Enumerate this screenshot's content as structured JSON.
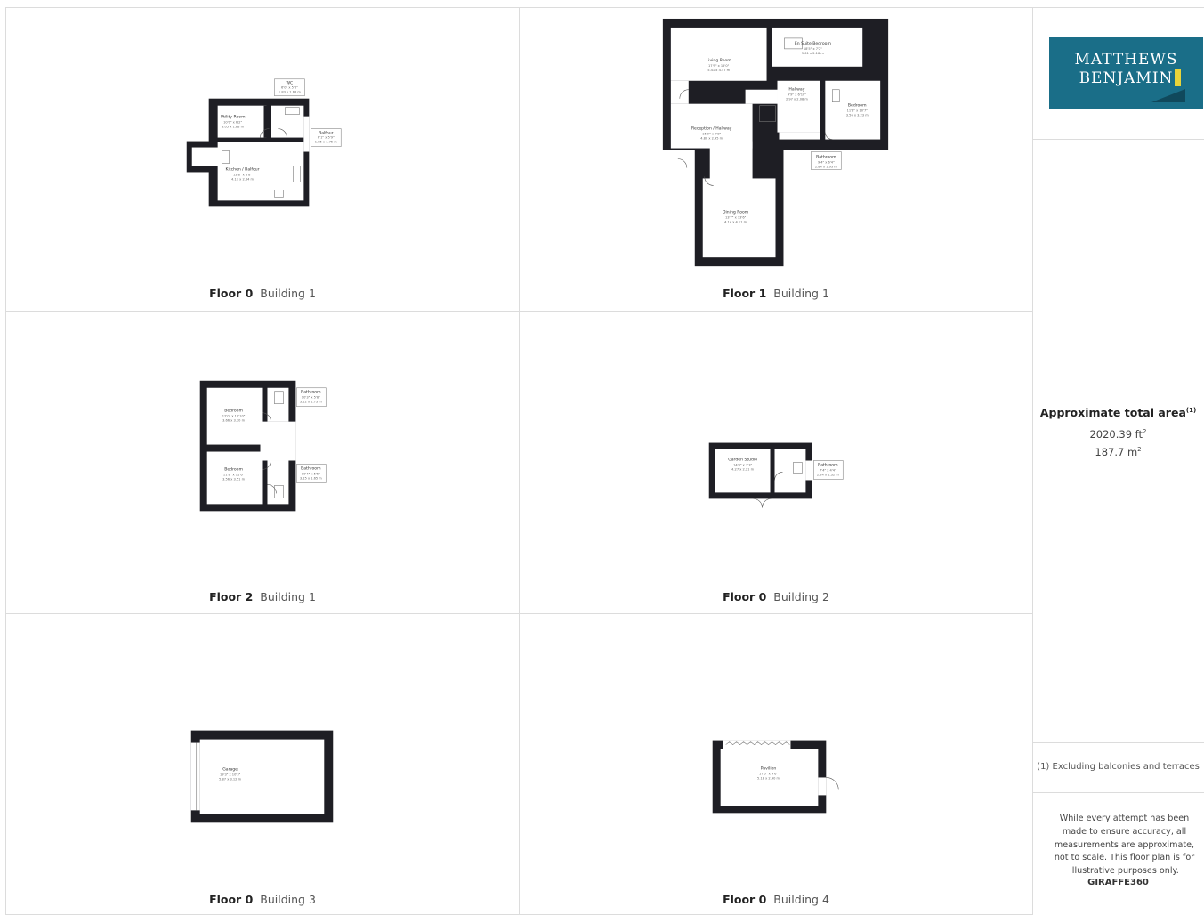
{
  "plans": [
    {
      "floor": "Floor 0",
      "building": "Building 1",
      "rooms": [
        {
          "name": "Utility Room",
          "dims": "10'0\" x 6'2\"",
          "dims_m": "3.05 x 1.88 m"
        },
        {
          "name": "Kitchen / Balfour",
          "dims": "13'8\" x 8'8\"",
          "dims_m": "4.17 x 2.64 m"
        },
        {
          "name": "WC",
          "dims": "6'0\" x 5'6\"",
          "dims_m": "1.83 x 1.68 m"
        },
        {
          "name": "Balfour",
          "dims": "6'1\" x 5'9\"",
          "dims_m": "1.85 x 1.75 m"
        }
      ]
    },
    {
      "floor": "Floor 1",
      "building": "Building 1",
      "rooms": [
        {
          "name": "Living Room",
          "dims": "17'9\" x 15'0\"",
          "dims_m": "5.41 x 4.57 m"
        },
        {
          "name": "En Suite Bedroom",
          "dims": "18'5\" x 7'2\"",
          "dims_m": "5.61 x 2.18 m"
        },
        {
          "name": "Hallway",
          "dims": "9'9\" x 6'10\"",
          "dims_m": "2.97 x 2.08 m"
        },
        {
          "name": "Bedroom",
          "dims": "11'8\" x 10'7\"",
          "dims_m": "3.56 x 3.23 m"
        },
        {
          "name": "Reception / Hallway",
          "dims": "15'9\" x 9'8\"",
          "dims_m": "4.80 x 2.95 m"
        },
        {
          "name": "Bathroom",
          "dims": "9'4\" x 6'4\"",
          "dims_m": "2.84 x 1.93 m"
        },
        {
          "name": "Dining Room",
          "dims": "13'7\" x 13'6\"",
          "dims_m": "4.14 x 4.11 m"
        }
      ]
    },
    {
      "floor": "Floor 2",
      "building": "Building 1",
      "rooms": [
        {
          "name": "Bedroom",
          "dims": "12'0\" x 10'10\"",
          "dims_m": "3.66 x 3.30 m"
        },
        {
          "name": "Bathroom",
          "dims": "10'3\" x 5'8\"",
          "dims_m": "3.12 x 1.73 m"
        },
        {
          "name": "Bedroom",
          "dims": "11'8\" x 11'6\"",
          "dims_m": "3.56 x 3.51 m"
        },
        {
          "name": "Bathroom",
          "dims": "10'4\" x 5'5\"",
          "dims_m": "3.15 x 1.65 m"
        }
      ]
    },
    {
      "floor": "Floor 0",
      "building": "Building 2",
      "rooms": [
        {
          "name": "Garden Studio",
          "dims": "14'0\" x 7'3\"",
          "dims_m": "4.27 x 2.21 m"
        },
        {
          "name": "Bathroom",
          "dims": "7'4\" x 4'4\"",
          "dims_m": "2.24 x 1.32 m"
        }
      ]
    },
    {
      "floor": "Floor 0",
      "building": "Building 3",
      "rooms": [
        {
          "name": "Garage",
          "dims": "19'3\" x 10'3\"",
          "dims_m": "5.87 x 3.12 m"
        }
      ]
    },
    {
      "floor": "Floor 0",
      "building": "Building 4",
      "rooms": [
        {
          "name": "Pavilion",
          "dims": "17'0\" x 9'6\"",
          "dims_m": "5.18 x 2.90 m"
        }
      ]
    }
  ],
  "sidebar": {
    "logo_line1": "MATTHEWS",
    "logo_line2": "BENJAMIN",
    "area_title": "Approximate total area",
    "area_title_sup": "(1)",
    "area_sqft": "2020.39 ft",
    "area_sqm": "187.7 m",
    "area_sup": "2",
    "footnote": "(1) Excluding balconies and terraces",
    "disclaimer": "While every attempt has been made to ensure accuracy, all measurements are approximate, not to scale. This floor plan is for illustrative purposes only.",
    "brand": "GIRAFFE360"
  },
  "colors": {
    "wall": "#1e1e24",
    "logo_bg": "#1a6e88",
    "logo_accent": "#e8d43a",
    "grid_line": "#dcdcdc"
  }
}
